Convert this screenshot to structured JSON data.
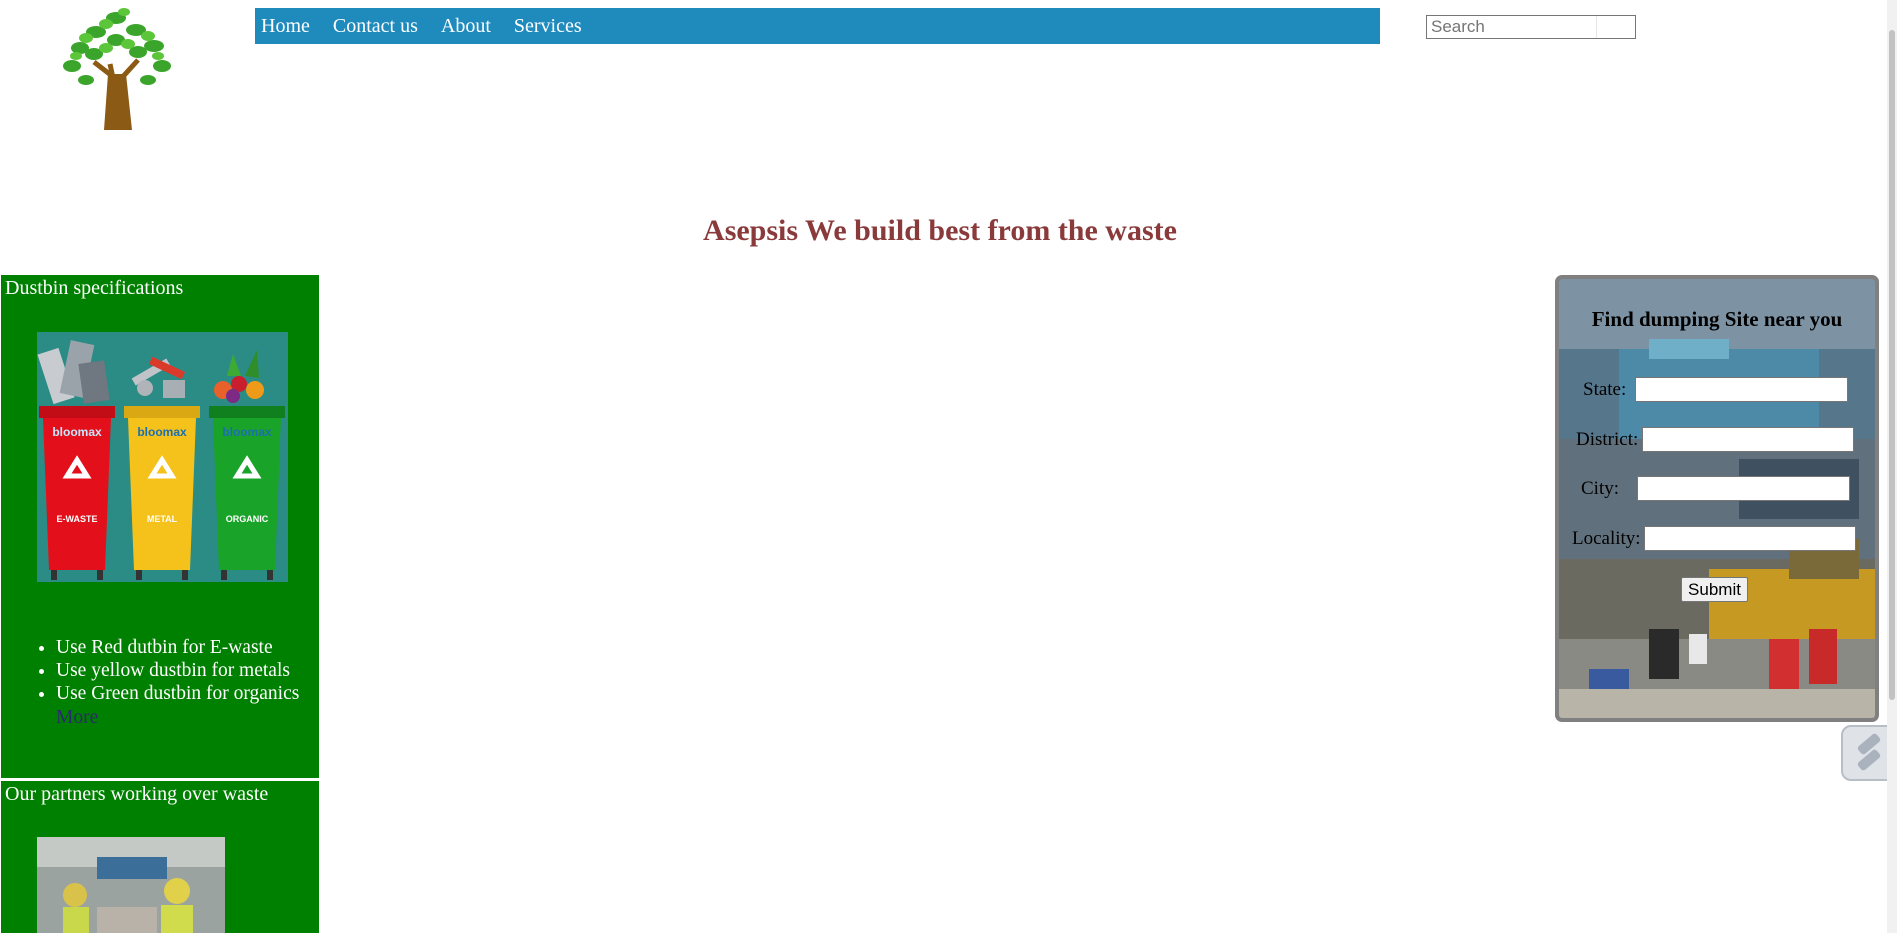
{
  "nav": {
    "links": [
      "Home",
      "Contact us",
      "About",
      "Services"
    ]
  },
  "search": {
    "placeholder": "Search"
  },
  "hero": {
    "title": "Asepsis We build best from the waste"
  },
  "dustbin_panel": {
    "title": "Dustbin specifications",
    "bins": [
      "E-WASTE",
      "METAL",
      "ORGANIC"
    ],
    "bin_brand": "bloomax",
    "tips": [
      "Use Red dutbin for E-waste",
      "Use yellow dustbin for metals",
      "Use Green dustbin for organics"
    ],
    "more_label": "More"
  },
  "partners_panel": {
    "title": "Our partners working over waste"
  },
  "form": {
    "heading": "Find dumping Site near you",
    "state_label": "State:",
    "district_label": "District:",
    "city_label": "City:",
    "locality_label": "Locality:",
    "submit_label": "Submit"
  },
  "colors": {
    "nav_bg": "#1f8bbd",
    "panel_green": "#008000",
    "title_color": "#8a3a3a",
    "bin_red": "#e3101b",
    "bin_yellow": "#f5c21b",
    "bin_green": "#1aa329"
  },
  "icons": {
    "logo": "tree-logo",
    "widget": "extension-widget-icon"
  }
}
